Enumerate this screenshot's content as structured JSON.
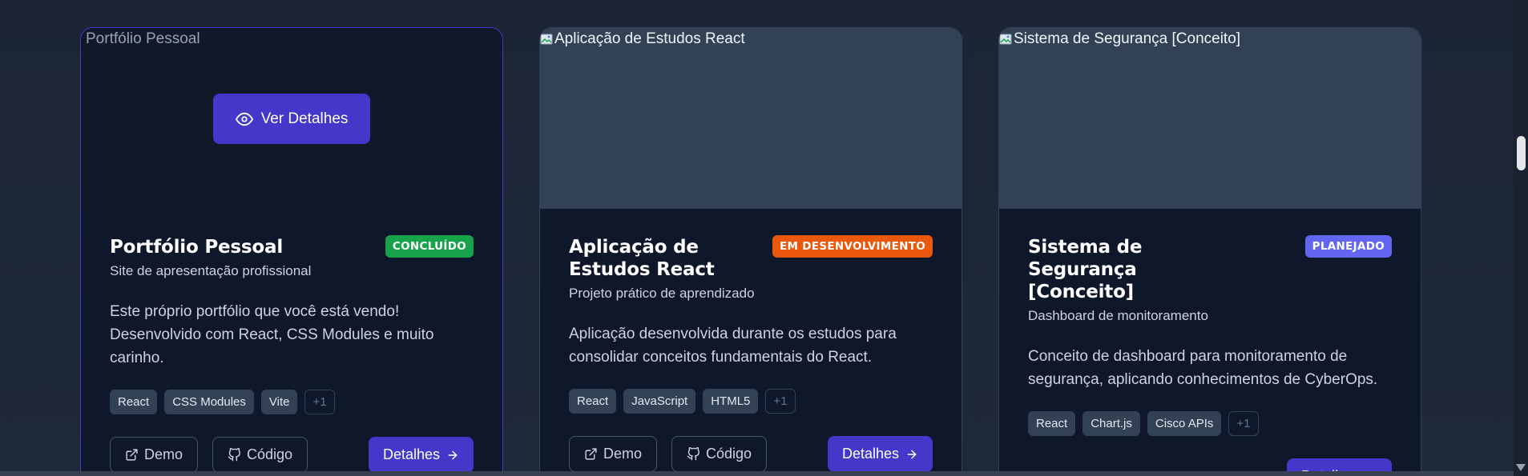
{
  "colors": {
    "accent": "#4338ca",
    "status_completed": "#16a34a",
    "status_in_progress": "#ea580c",
    "status_planned": "#6366f1"
  },
  "overlay": {
    "label": "Ver Detalhes",
    "icon": "eye-icon"
  },
  "cards": [
    {
      "image_alt": "Portfólio Pessoal",
      "title": "Portfólio Pessoal",
      "status": "CONCLUÍDO",
      "subtitle": "Site de apresentação profissional",
      "description": "Este próprio portfólio que você está vendo! Desenvolvido com React, CSS Modules e muito carinho.",
      "tags": [
        "React",
        "CSS Modules",
        "Vite",
        "+1"
      ],
      "actions": {
        "demo": "Demo",
        "code": "Código",
        "details": "Detalhes"
      }
    },
    {
      "image_alt": "Aplicação de Estudos React",
      "title": "Aplicação de Estudos React",
      "status": "EM DESENVOLVIMENTO",
      "subtitle": "Projeto prático de aprendizado",
      "description": "Aplicação desenvolvida durante os estudos para consolidar conceitos fundamentais do React.",
      "tags": [
        "React",
        "JavaScript",
        "HTML5",
        "+1"
      ],
      "actions": {
        "demo": "Demo",
        "code": "Código",
        "details": "Detalhes"
      }
    },
    {
      "image_alt": "Sistema de Segurança [Conceito]",
      "title": "Sistema de Segurança [Conceito]",
      "status": "PLANEJADO",
      "subtitle": "Dashboard de monitoramento",
      "description": "Conceito de dashboard para monitoramento de segurança, aplicando conhecimentos de CyberOps.",
      "tags": [
        "React",
        "Chart.js",
        "Cisco APIs",
        "+1"
      ],
      "actions": {
        "details": "Detalhes"
      }
    }
  ]
}
